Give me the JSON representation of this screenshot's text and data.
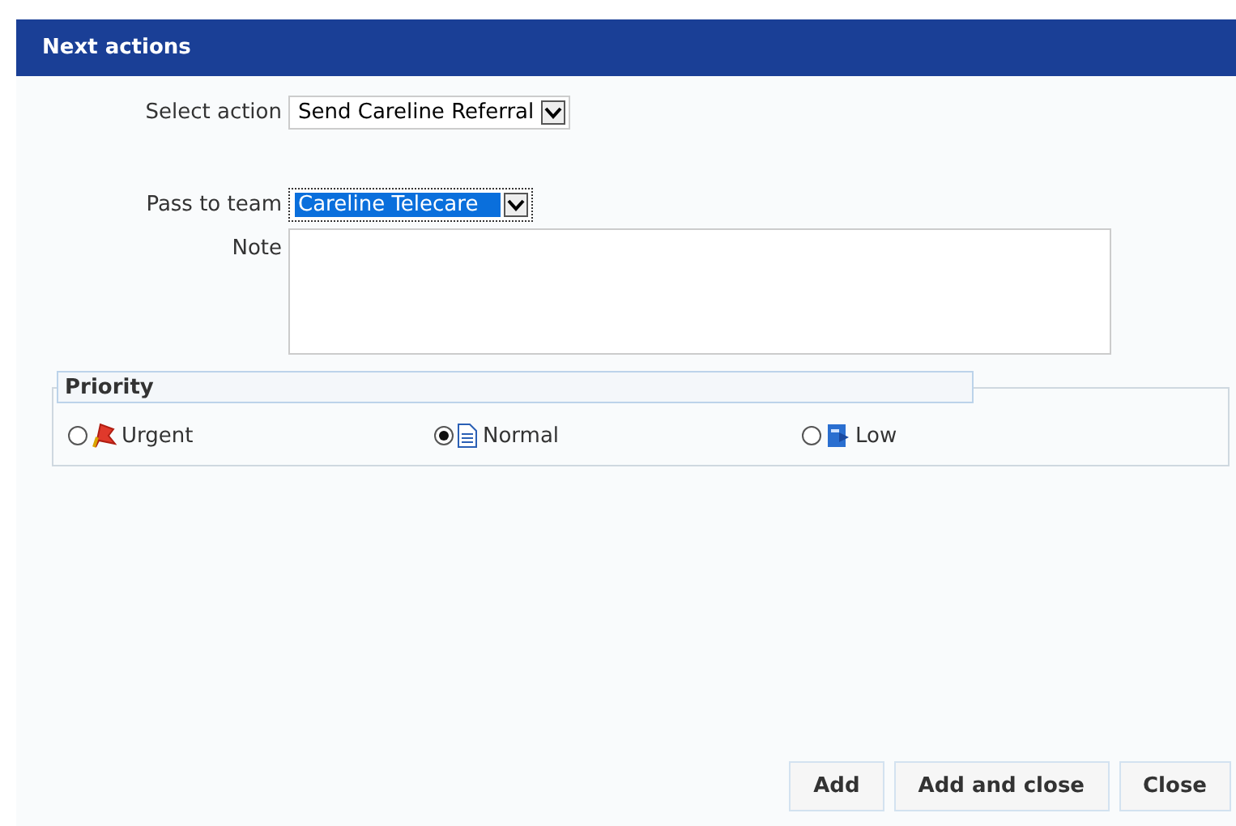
{
  "dialog": {
    "title": "Next actions"
  },
  "select_action": {
    "label": "Select action",
    "value": "Send Careline Referral"
  },
  "pass_to_team": {
    "label": "Pass to team",
    "value": "Careline Telecare",
    "focused": true
  },
  "note": {
    "label": "Note"
  },
  "priority": {
    "legend": "Priority",
    "options": [
      {
        "label": "Urgent",
        "kind": "urgent",
        "selected": false
      },
      {
        "label": "Normal",
        "kind": "normal",
        "selected": true
      },
      {
        "label": "Low",
        "kind": "low",
        "selected": false
      }
    ]
  },
  "buttons": [
    "Add",
    "Add and close",
    "Close"
  ]
}
